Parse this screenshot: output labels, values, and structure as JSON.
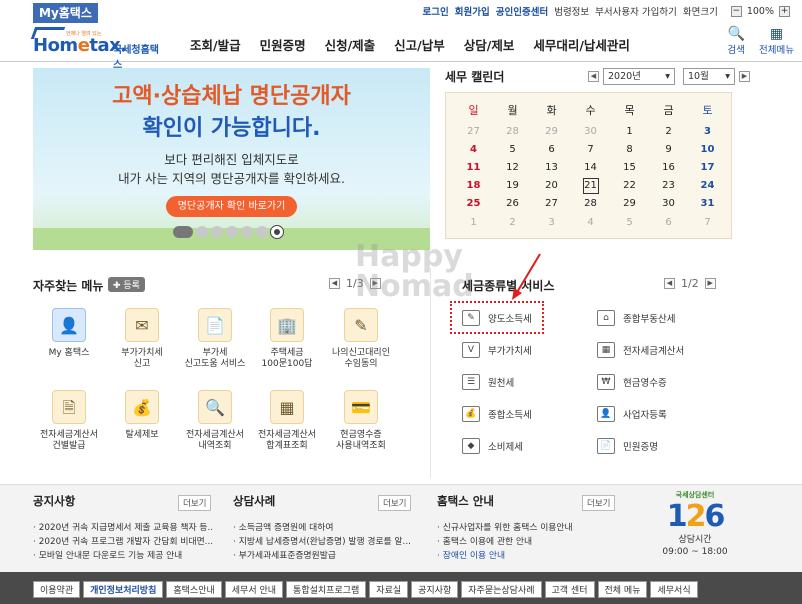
{
  "topbar": {
    "my_tab": "My홈택스",
    "links": [
      "로그인",
      "회원가입",
      "공인인증센터",
      "범령정보",
      "부서사용자 가입하기",
      "화면크기"
    ],
    "zoom": "100%"
  },
  "header": {
    "logo_text_a": "Hom",
    "logo_text_e": "e",
    "logo_text_b": "tax.",
    "logo_sub": "국세청홈택스",
    "logo_tiny": "언제나 열려 있는",
    "nav": [
      "조회/발급",
      "민원증명",
      "신청/제출",
      "신고/납부",
      "상담/제보",
      "세무대리/납세관리"
    ],
    "search_label": "검색",
    "menu_label": "전체메뉴"
  },
  "banner": {
    "title1": "고액·상습체납 명단공개자",
    "title2": "확인이 가능합니다.",
    "desc1": "보다 편리해진 입체지도로",
    "desc2": "내가 사는 지역의 명단공개자를 확인하세요.",
    "button": "명단공개자 확인 바로가기"
  },
  "calendar": {
    "title": "세무 캘린더",
    "year": "2020년",
    "month": "10월",
    "days": [
      "일",
      "월",
      "화",
      "수",
      "목",
      "금",
      "토"
    ],
    "weeks": [
      [
        "27",
        "28",
        "29",
        "30",
        "1",
        "2",
        "3"
      ],
      [
        "4",
        "5",
        "6",
        "7",
        "8",
        "9",
        "10"
      ],
      [
        "11",
        "12",
        "13",
        "14",
        "15",
        "16",
        "17"
      ],
      [
        "18",
        "19",
        "20",
        "21",
        "22",
        "23",
        "24"
      ],
      [
        "25",
        "26",
        "27",
        "28",
        "29",
        "30",
        "31"
      ],
      [
        "1",
        "2",
        "3",
        "4",
        "5",
        "6",
        "7"
      ]
    ]
  },
  "favorites": {
    "title": "자주찾는 메뉴",
    "register": "등록",
    "page": "1/3",
    "items": [
      {
        "label1": "My 홈택스",
        "label2": "",
        "icon": "user-icon"
      },
      {
        "label1": "부가가치세",
        "label2": "신고",
        "icon": "vat-icon"
      },
      {
        "label1": "부가세",
        "label2": "신고도움 서비스",
        "icon": "help-doc-icon"
      },
      {
        "label1": "주택세금",
        "label2": "100문100답",
        "icon": "house-icon"
      },
      {
        "label1": "나의신고대리인",
        "label2": "수임동의",
        "icon": "agent-icon"
      },
      {
        "label1": "전자세금계산서",
        "label2": "건별발급",
        "icon": "invoice-icon"
      },
      {
        "label1": "탈세제보",
        "label2": "",
        "icon": "tax-report-icon"
      },
      {
        "label1": "전자세금계산서",
        "label2": "내역조회",
        "icon": "invoice-search-icon"
      },
      {
        "label1": "전자세금계산서",
        "label2": "합계표조회",
        "icon": "invoice-sum-icon"
      },
      {
        "label1": "현금영수증",
        "label2": "사용내역조회",
        "icon": "receipt-icon"
      }
    ]
  },
  "services": {
    "title": "세금종류별 서비스",
    "page": "1/2",
    "items": [
      {
        "label": "양도소득세",
        "icon": "transfer-tax-icon"
      },
      {
        "label": "종합부동산세",
        "icon": "property-tax-icon"
      },
      {
        "label": "부가가치세",
        "icon": "vat-icon"
      },
      {
        "label": "전자세금계산서",
        "icon": "e-invoice-icon"
      },
      {
        "label": "원천세",
        "icon": "withholding-icon"
      },
      {
        "label": "현금영수증",
        "icon": "cash-receipt-icon"
      },
      {
        "label": "종합소득세",
        "icon": "income-tax-icon"
      },
      {
        "label": "사업자등록",
        "icon": "business-reg-icon"
      },
      {
        "label": "소비제세",
        "icon": "consumption-tax-icon"
      },
      {
        "label": "민원증명",
        "icon": "certificate-icon"
      }
    ]
  },
  "watermark": {
    "line1": "Happy",
    "line2": "Nomad"
  },
  "footer": {
    "notice": {
      "title": "공지사항",
      "more": "더보기",
      "items": [
        "2020년 귀속 지급명세서 제출 교육용 책자 등..",
        "2020년 귀속 프로그램 개발자 간담회 비대면...",
        "모바일 안내문 다운로드 기능 제공 안내"
      ]
    },
    "cases": {
      "title": "상담사례",
      "more": "더보기",
      "items": [
        "소득금액 증명원에 대하여",
        "지방세 납세증명서(완납증명) 발행 경로를 알...",
        "부가세과세표준증명원발급"
      ]
    },
    "guide": {
      "title": "홈택스 안내",
      "more": "더보기",
      "items": [
        "신규사업자를 위한 홈택스 이용안내",
        "홈택스 이용에 관한 안내",
        "장애인 이용 안내"
      ]
    },
    "center": {
      "label": "국세상담센터",
      "num_a": "1",
      "num_b": "2",
      "num_c": "6",
      "hours_label": "상담시간",
      "hours": "09:00 ~ 18:00"
    }
  },
  "bottom_links": [
    "이용약관",
    "개인정보처리방침",
    "홈택스안내",
    "세무서 안내",
    "통합설치프로그램",
    "자료실",
    "공지사항",
    "자주묻는상담사례",
    "고객 센터",
    "전체 메뉴",
    "세무서식"
  ]
}
